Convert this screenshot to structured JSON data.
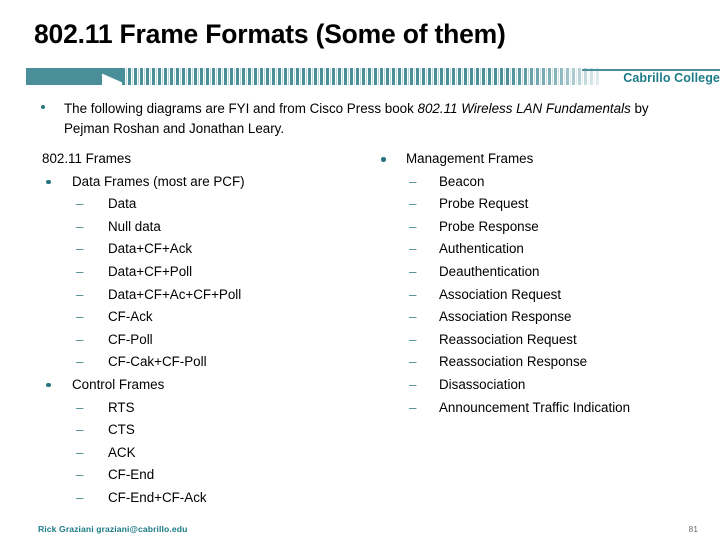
{
  "slide": {
    "title": "802.11 Frame Formats (Some of them)",
    "page_number": "81"
  },
  "banner": {
    "brand": "Cabrillo College",
    "accent_color": "#4a8e99",
    "brand_color": "#1b7b86"
  },
  "intro": {
    "bullet_parts": {
      "part1": "The following diagrams are FYI and from Cisco Press book ",
      "italic1": "802.11 Wireless LAN Fundamentals",
      "part2": " by Pejman Roshan and Jonathan Leary."
    },
    "full_text": "The following diagrams are FYI and from Cisco Press book 802.11 Wireless LAN Fundamentals by Pejman Roshan and Jonathan Leary."
  },
  "left_column": {
    "items": [
      {
        "level": 0,
        "label": "802.11 Frames"
      },
      {
        "level": 1,
        "label": "Data Frames (most are PCF)"
      },
      {
        "level": 2,
        "label": "Data"
      },
      {
        "level": 2,
        "label": "Null data"
      },
      {
        "level": 2,
        "label": "Data+CF+Ack"
      },
      {
        "level": 2,
        "label": "Data+CF+Poll"
      },
      {
        "level": 2,
        "label": "Data+CF+Ac+CF+Poll"
      },
      {
        "level": 2,
        "label": "CF-Ack"
      },
      {
        "level": 2,
        "label": "CF-Poll"
      },
      {
        "level": 2,
        "label": "CF-Cak+CF-Poll"
      },
      {
        "level": 1,
        "label": "Control Frames"
      },
      {
        "level": 2,
        "label": "RTS"
      },
      {
        "level": 2,
        "label": "CTS"
      },
      {
        "level": 2,
        "label": "ACK"
      },
      {
        "level": 2,
        "label": "CF-End"
      },
      {
        "level": 2,
        "label": "CF-End+CF-Ack"
      }
    ]
  },
  "right_column": {
    "items": [
      {
        "level": 1,
        "label": "Management Frames"
      },
      {
        "level": 2,
        "label": "Beacon"
      },
      {
        "level": 2,
        "label": "Probe Request"
      },
      {
        "level": 2,
        "label": "Probe Response"
      },
      {
        "level": 2,
        "label": "Authentication"
      },
      {
        "level": 2,
        "label": "Deauthentication"
      },
      {
        "level": 2,
        "label": "Association Request"
      },
      {
        "level": 2,
        "label": "Association Response"
      },
      {
        "level": 2,
        "label": "Reassociation Request"
      },
      {
        "level": 2,
        "label": "Reassociation Response"
      },
      {
        "level": 2,
        "label": "Disassociation"
      },
      {
        "level": 2,
        "label": "Announcement Traffic Indication"
      }
    ]
  },
  "footer": {
    "credit": "Rick Graziani  graziani@cabrillo.edu",
    "page": "81"
  },
  "markers": {
    "dash": "–"
  }
}
